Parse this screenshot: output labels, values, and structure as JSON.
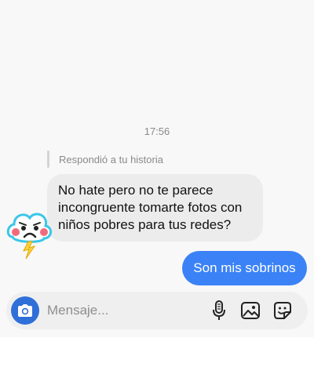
{
  "chat": {
    "timestamp": "17:56",
    "reply_context": "Respondió a tu historia",
    "incoming_message": "No hate pero no te parece incongruente tomarte fotos con niños pobres para tus redes?",
    "outgoing_message": "Son mis sobrinos",
    "incoming_bubble_color": "#ececec",
    "outgoing_bubble_color": "#3b82f6",
    "sticker": "sad-cloud-sticker"
  },
  "composer": {
    "placeholder": "Mensaje...",
    "value": "",
    "icons": [
      "camera-icon",
      "microphone-icon",
      "image-icon",
      "sticker-icon"
    ]
  }
}
